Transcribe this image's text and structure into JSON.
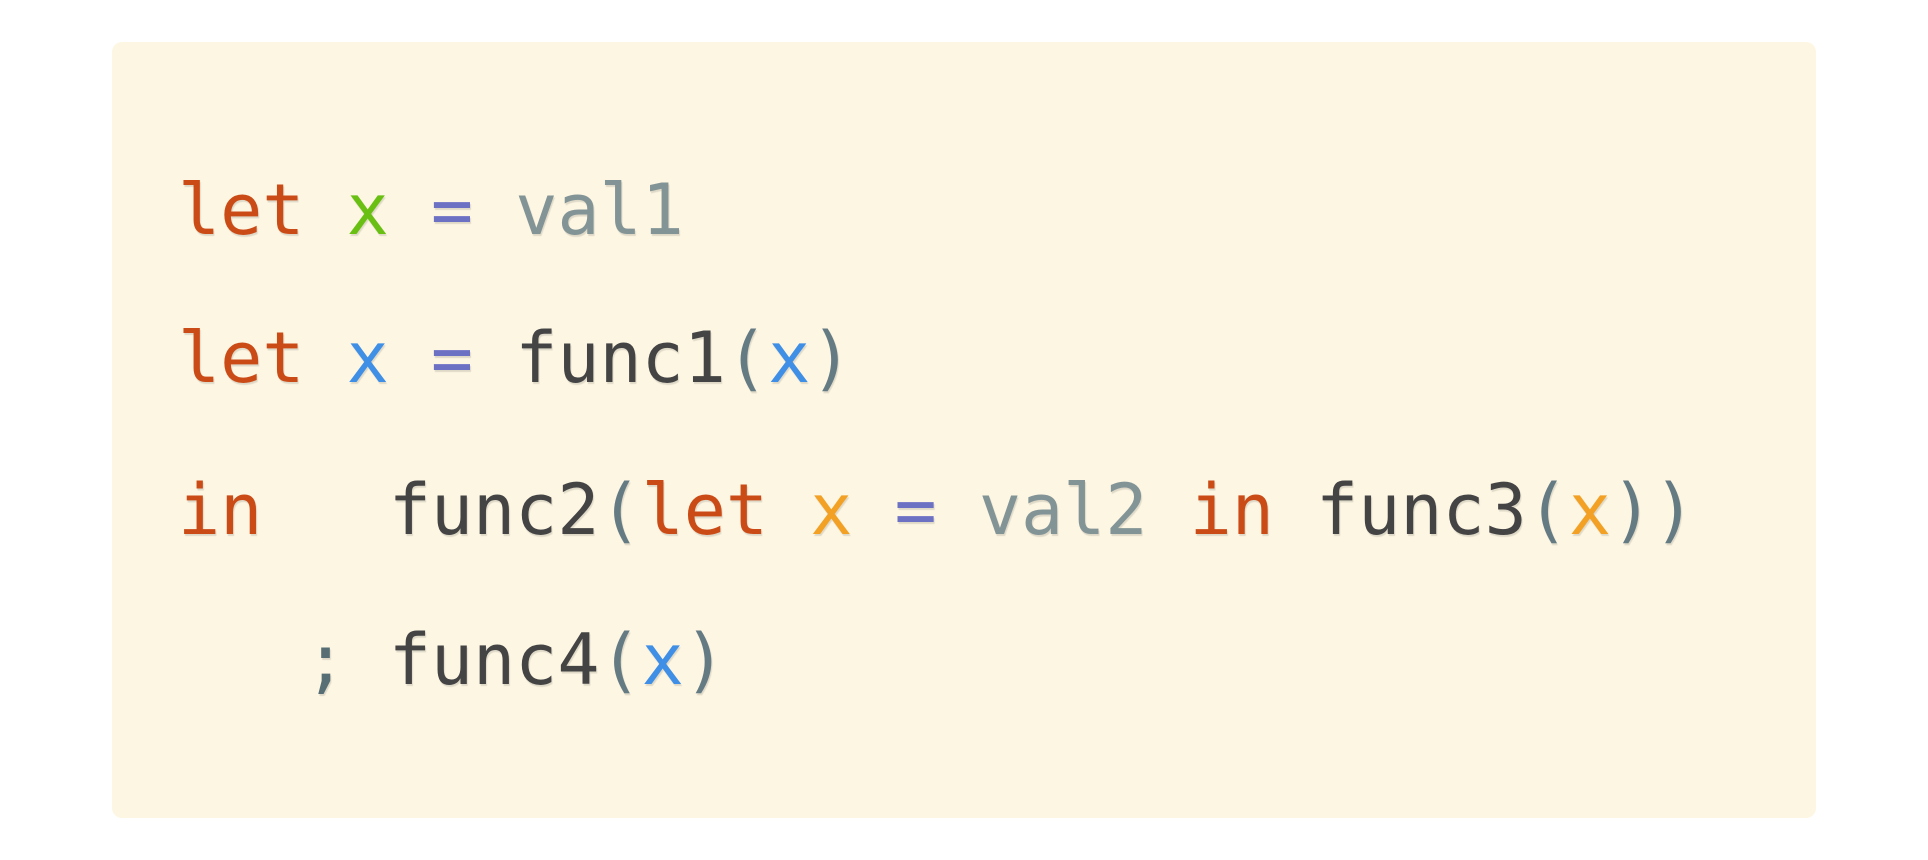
{
  "colors": {
    "keyword": "#cb4b16",
    "var_green": "#6ac012",
    "var_blue": "#3f8fe6",
    "var_orange": "#f2a125",
    "operator": "#6c71c4",
    "value": "#839496",
    "function": "#444444",
    "paren": "#657b83",
    "punct": "#586e75",
    "background": "#fdf6e3"
  },
  "code": {
    "lines": [
      {
        "tokens": [
          {
            "text": "let",
            "kind": "keyword"
          },
          {
            "text": " ",
            "kind": "space"
          },
          {
            "text": "x",
            "kind": "var_green"
          },
          {
            "text": " ",
            "kind": "space"
          },
          {
            "text": "=",
            "kind": "operator"
          },
          {
            "text": " ",
            "kind": "space"
          },
          {
            "text": "val1",
            "kind": "value"
          }
        ]
      },
      {
        "tokens": [
          {
            "text": "let",
            "kind": "keyword"
          },
          {
            "text": " ",
            "kind": "space"
          },
          {
            "text": "x",
            "kind": "var_blue"
          },
          {
            "text": " ",
            "kind": "space"
          },
          {
            "text": "=",
            "kind": "operator"
          },
          {
            "text": " ",
            "kind": "space"
          },
          {
            "text": "func1",
            "kind": "function"
          },
          {
            "text": "(",
            "kind": "paren"
          },
          {
            "text": "x",
            "kind": "var_blue"
          },
          {
            "text": ")",
            "kind": "paren"
          }
        ]
      },
      {
        "tokens": [
          {
            "text": "in",
            "kind": "keyword"
          },
          {
            "text": "   ",
            "kind": "space"
          },
          {
            "text": "func2",
            "kind": "function"
          },
          {
            "text": "(",
            "kind": "paren"
          },
          {
            "text": "let",
            "kind": "keyword"
          },
          {
            "text": " ",
            "kind": "space"
          },
          {
            "text": "x",
            "kind": "var_orange"
          },
          {
            "text": " ",
            "kind": "space"
          },
          {
            "text": "=",
            "kind": "operator"
          },
          {
            "text": " ",
            "kind": "space"
          },
          {
            "text": "val2",
            "kind": "value"
          },
          {
            "text": " ",
            "kind": "space"
          },
          {
            "text": "in",
            "kind": "keyword"
          },
          {
            "text": " ",
            "kind": "space"
          },
          {
            "text": "func3",
            "kind": "function"
          },
          {
            "text": "(",
            "kind": "paren"
          },
          {
            "text": "x",
            "kind": "var_orange"
          },
          {
            "text": "))",
            "kind": "paren"
          }
        ]
      },
      {
        "tokens": [
          {
            "text": "   ",
            "kind": "space"
          },
          {
            "text": ";",
            "kind": "punct"
          },
          {
            "text": " ",
            "kind": "space"
          },
          {
            "text": "func4",
            "kind": "function"
          },
          {
            "text": "(",
            "kind": "paren"
          },
          {
            "text": "x",
            "kind": "var_blue"
          },
          {
            "text": ")",
            "kind": "paren"
          }
        ]
      }
    ]
  }
}
